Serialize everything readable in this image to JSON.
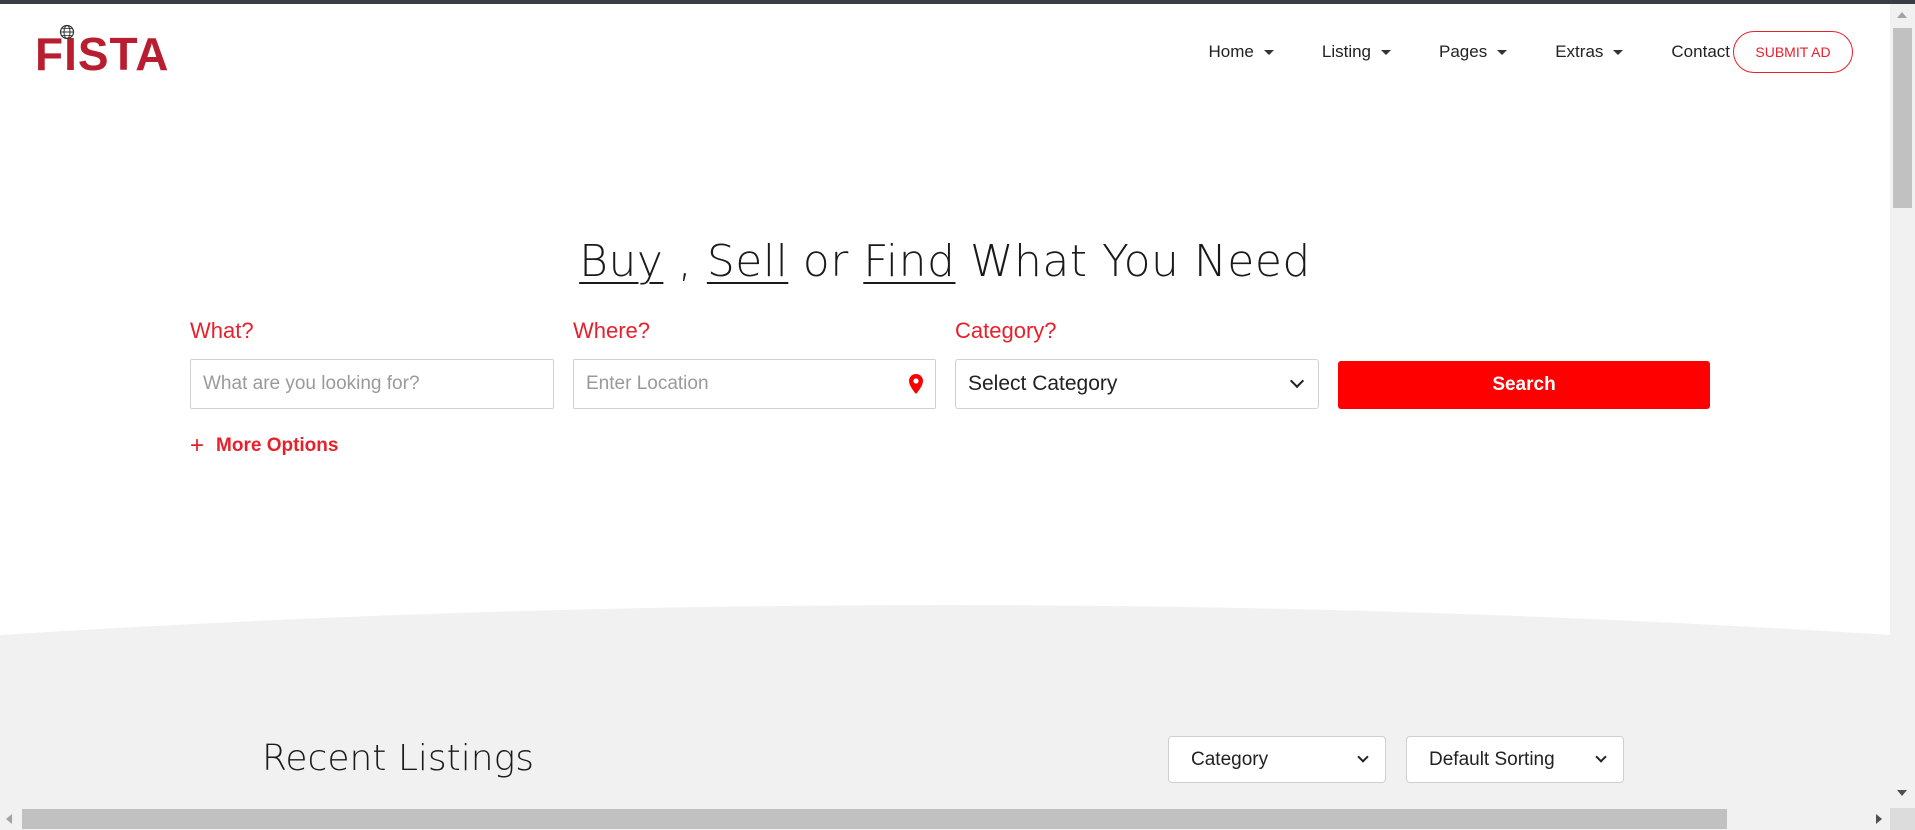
{
  "header": {
    "logo_text": "FISTA",
    "nav": [
      {
        "label": "Home",
        "has_dropdown": true
      },
      {
        "label": "Listing",
        "has_dropdown": true
      },
      {
        "label": "Pages",
        "has_dropdown": true
      },
      {
        "label": "Extras",
        "has_dropdown": true
      },
      {
        "label": "Contact",
        "has_dropdown": false
      }
    ],
    "submit_ad_label": "SUBMIT AD"
  },
  "hero": {
    "title_part1": "Buy",
    "title_sep1": " , ",
    "title_part2": "Sell",
    "title_sep2": " or ",
    "title_part3": "Find",
    "title_rest": " What You Need"
  },
  "search": {
    "what_label": "What?",
    "what_placeholder": "What are you looking for?",
    "where_label": "Where?",
    "where_placeholder": "Enter Location",
    "category_label": "Category?",
    "category_value": "Select Category",
    "search_button": "Search",
    "more_options": "More Options"
  },
  "recent": {
    "title": "Recent Listings",
    "category_filter": "Category",
    "sort_filter": "Default Sorting"
  },
  "colors": {
    "brand": "#b81e2f",
    "accent": "#ff0000",
    "label_red": "#e8202b",
    "section_gray": "#f1f1f1"
  },
  "icons": {
    "location": "map-pin-icon",
    "plus": "plus-icon",
    "caret": "caret-down-icon",
    "globe": "globe-icon"
  }
}
